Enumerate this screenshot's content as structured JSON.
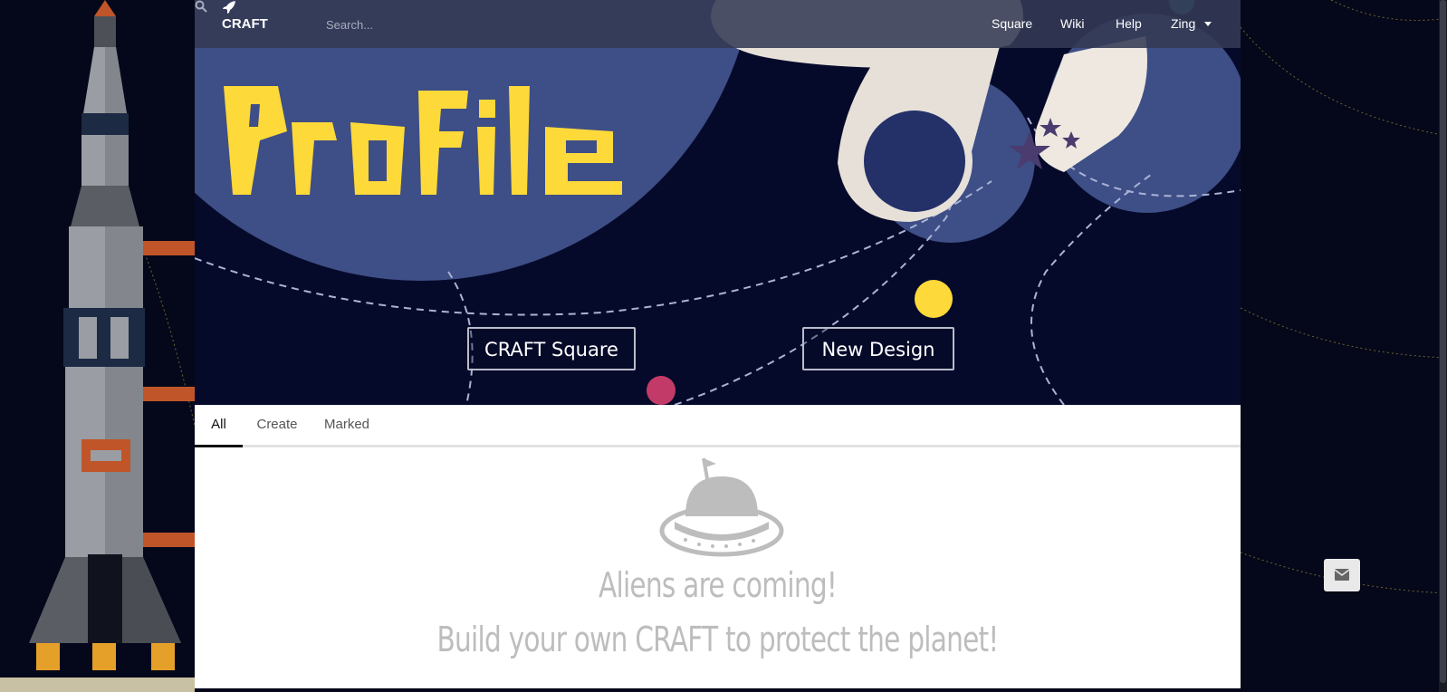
{
  "navbar": {
    "brand": "CRAFT",
    "search_placeholder": "Search...",
    "links": [
      "Square",
      "Wiki",
      "Help"
    ],
    "user": "Zing"
  },
  "hero": {
    "title": "Profile",
    "buttons": [
      "CRAFT Square",
      "New Design"
    ],
    "title_color": "#fdd93a",
    "planet_color": "#3e4e86"
  },
  "tabs": {
    "items": [
      "All",
      "Create",
      "Marked"
    ],
    "active": "All"
  },
  "empty_state": {
    "line1": "Aliens are coming!",
    "line2": "Build your own CRAFT to protect the planet!",
    "icon": "ufo-icon"
  },
  "floating": {
    "icon": "envelope-icon"
  }
}
